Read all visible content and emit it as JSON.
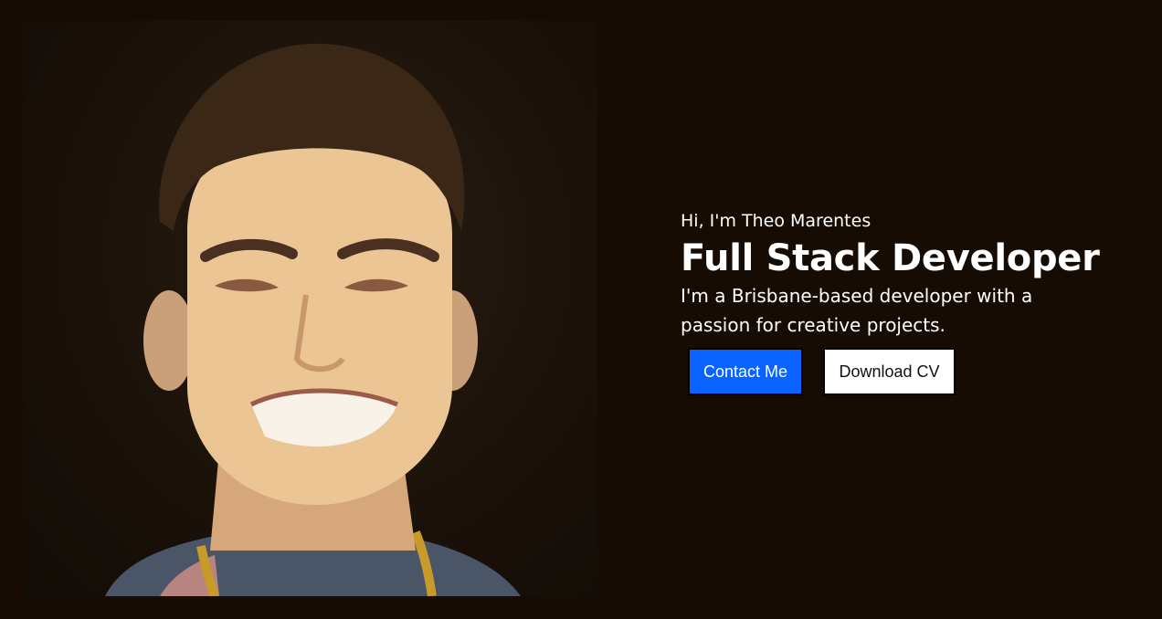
{
  "hero": {
    "photo_alt": "Portrait of Theo Marentes",
    "greeting": "Hi, I'm Theo Marentes",
    "headline": "Full Stack Developer",
    "bio": "I'm a Brisbane-based developer with a passion for creative projects.",
    "buttons": {
      "contact": "Contact Me",
      "download_cv": "Download CV"
    }
  },
  "colors": {
    "background": "#160c03",
    "primary_button": "#0a63ff",
    "secondary_button": "#ffffff",
    "text": "#ffffff"
  }
}
